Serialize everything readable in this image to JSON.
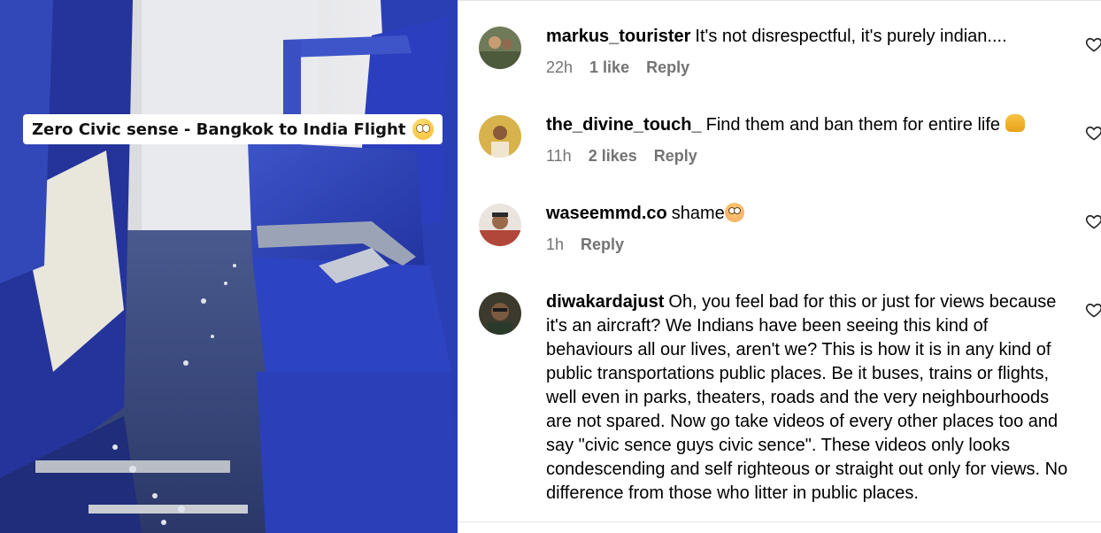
{
  "video": {
    "caption": "Zero Civic sense - Bangkok to India Flight",
    "caption_emoji": "rolling-eyes-emoji"
  },
  "comments": [
    {
      "username": "markus_tourister",
      "text": "It's not disrespectful, it's purely indian....",
      "time": "22h",
      "likes": "1 like",
      "reply": "Reply",
      "avatar_color": "#6f7a58"
    },
    {
      "username": "the_divine_touch_",
      "text": "Find them and ban them for entire life",
      "emoji": "folded-hands-emoji",
      "time": "11h",
      "likes": "2 likes",
      "reply": "Reply",
      "avatar_color": "#d8b24a"
    },
    {
      "username": "waseemmd.co",
      "text": "shame",
      "emoji": "flushed-face-emoji",
      "time": "1h",
      "reply": "Reply",
      "avatar_color": "#b1463a"
    },
    {
      "username": "diwakardajust",
      "text": "Oh, you feel bad for this or just for views because it's an aircraft? We Indians have been seeing this kind of behaviours all our lives, aren't we? This is how it is in any kind of public transportations public places. Be it buses, trains or flights, well even in parks, theaters, roads and the very neighbourhoods are not spared. Now go take videos of every other places too and say \"civic sence guys civic sence\". These videos only looks condescending and self righteous or straight out only for views. No difference from those who litter in public places.",
      "avatar_color": "#3c3a2c"
    }
  ]
}
